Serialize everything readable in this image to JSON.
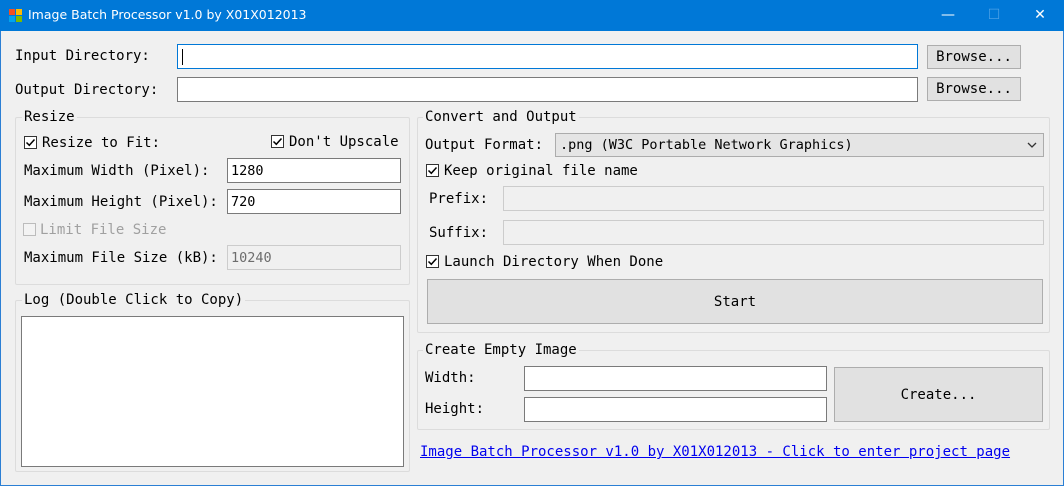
{
  "window": {
    "title": "Image Batch Processor v1.0 by X01X012013",
    "minimize": "—",
    "maximize": "☐",
    "close": "✕"
  },
  "io": {
    "input_label": "Input Directory:",
    "input_value": "",
    "output_label": "Output Directory:",
    "output_value": "",
    "browse_label": "Browse..."
  },
  "resize": {
    "title": "Resize",
    "resize_to_fit_label": "Resize to Fit:",
    "resize_to_fit_checked": true,
    "dont_upscale_label": "Don't Upscale",
    "dont_upscale_checked": true,
    "max_width_label": "Maximum Width (Pixel):",
    "max_width_value": "1280",
    "max_height_label": "Maximum Height (Pixel):",
    "max_height_value": "720",
    "limit_size_label": "Limit File Size",
    "limit_size_checked": false,
    "max_file_size_label": "Maximum File Size (kB):",
    "max_file_size_value": "10240"
  },
  "log": {
    "title": "Log (Double Click to Copy)"
  },
  "convert": {
    "title": "Convert and Output",
    "format_label": "Output Format:",
    "format_selected": ".png (W3C Portable Network Graphics)",
    "keep_name_label": "Keep original file name",
    "keep_name_checked": true,
    "prefix_label": "Prefix:",
    "prefix_value": "",
    "suffix_label": "Suffix:",
    "suffix_value": "",
    "launch_dir_label": "Launch Directory When Done",
    "launch_dir_checked": true,
    "start_label": "Start"
  },
  "create_empty": {
    "title": "Create Empty Image",
    "width_label": "Width:",
    "width_value": "",
    "height_label": "Height:",
    "height_value": "",
    "create_label": "Create..."
  },
  "footer": {
    "link_text": "Image Batch Processor v1.0 by X01X012013 - Click to enter project page"
  },
  "colors": {
    "titlebar": "#0078d7",
    "link": "#0000ee",
    "window_bg": "#f0f0f0"
  }
}
